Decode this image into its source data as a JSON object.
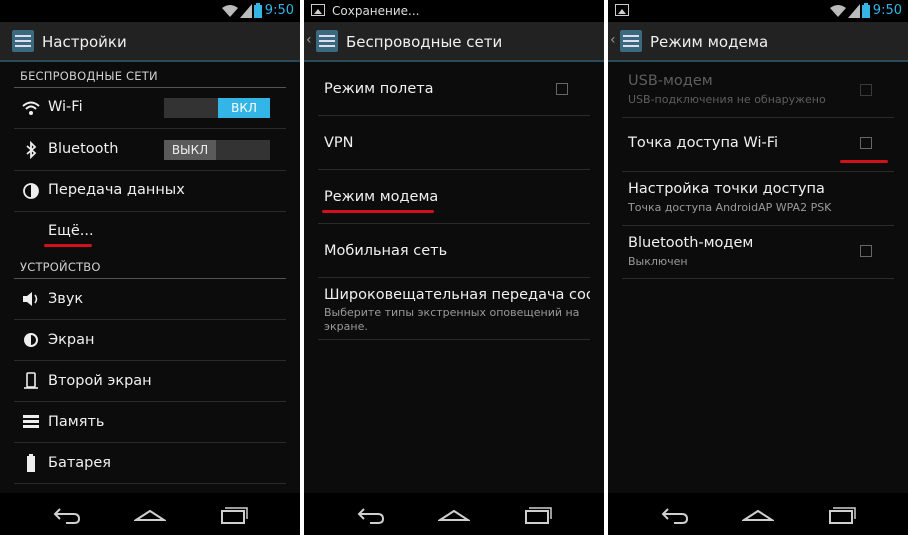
{
  "status": {
    "time": "9:50",
    "notification": "Сохранение..."
  },
  "screen1": {
    "title": "Настройки",
    "section_wireless": "БЕСПРОВОДНЫЕ СЕТИ",
    "section_device": "УСТРОЙСТВО",
    "wifi": {
      "label": "Wi-Fi",
      "toggle": "ВКЛ"
    },
    "bluetooth": {
      "label": "Bluetooth",
      "toggle": "ВЫКЛ"
    },
    "data_usage": "Передача данных",
    "more": "Ещё...",
    "sound": "Звук",
    "display": "Экран",
    "second_screen": "Второй экран",
    "storage": "Память",
    "battery": "Батарея"
  },
  "screen2": {
    "title": "Беспроводные сети",
    "airplane": "Режим полета",
    "vpn": "VPN",
    "tethering": "Режим модема",
    "mobile": "Мобильная сеть",
    "broadcast_title": "Широковещательная передача соо",
    "broadcast_sub1": "Выберите типы экстренных оповещений на",
    "broadcast_sub2": "экране."
  },
  "screen3": {
    "title": "Режим модема",
    "usb_title": "USB-модем",
    "usb_sub": "USB-подключения не обнаружено",
    "hotspot_title": "Точка доступа Wi-Fi",
    "hotspot_setup_title": "Настройка точки доступа",
    "hotspot_setup_sub": "Точка доступа AndroidAP WPA2 PSK",
    "bt_title": "Bluetooth-модем",
    "bt_sub": "Выключен"
  },
  "colors": {
    "accent": "#33b5e5",
    "annotation": "#d0101a",
    "background": "#0c0c0c"
  }
}
